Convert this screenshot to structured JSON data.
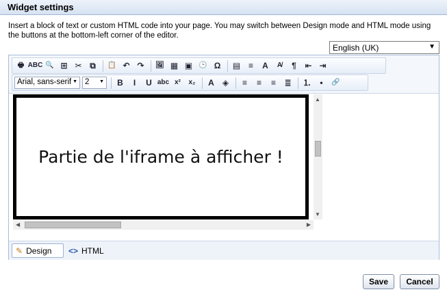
{
  "dialog": {
    "title": "Widget settings",
    "description": "Insert a block of text or custom HTML code into your page. You may switch between Design mode and HTML mode using the buttons at the bottom-left corner of the editor."
  },
  "language": {
    "selected": "English (UK)"
  },
  "toolbar": {
    "row1": [
      {
        "name": "print-icon",
        "glyph": "🖶"
      },
      {
        "name": "spellcheck-icon",
        "glyph": "ABC"
      },
      {
        "name": "find-icon",
        "glyph": "🔍"
      },
      {
        "name": "select-all-icon",
        "glyph": "⊞"
      },
      {
        "name": "cut-icon",
        "glyph": "✂"
      },
      {
        "name": "copy-icon",
        "glyph": "⧉"
      },
      {
        "name": "paste-icon",
        "glyph": "📋"
      },
      {
        "name": "undo-icon",
        "glyph": "↶"
      },
      {
        "name": "redo-icon",
        "glyph": "↷"
      },
      {
        "name": "insert-image-icon",
        "glyph": "🖼"
      },
      {
        "name": "image-gallery-icon",
        "glyph": "▦"
      },
      {
        "name": "insert-media-icon",
        "glyph": "▣"
      },
      {
        "name": "insert-date-icon",
        "glyph": "🕒"
      },
      {
        "name": "special-char-icon",
        "glyph": "Ω"
      },
      {
        "name": "table-icon",
        "glyph": "▤"
      },
      {
        "name": "paragraph-icon",
        "glyph": "≡"
      },
      {
        "name": "text-color-icon",
        "glyph": "A"
      },
      {
        "name": "clear-format-icon",
        "glyph": "A̸"
      },
      {
        "name": "show-marks-icon",
        "glyph": "¶"
      },
      {
        "name": "outdent-icon",
        "glyph": "⇤"
      },
      {
        "name": "indent-icon",
        "glyph": "⇥"
      }
    ],
    "font_family": "Arial, sans-serif",
    "font_size": "2",
    "row2": [
      {
        "name": "bold-icon",
        "glyph": "B"
      },
      {
        "name": "italic-icon",
        "glyph": "I"
      },
      {
        "name": "underline-icon",
        "glyph": "U"
      },
      {
        "name": "strikethrough-icon",
        "glyph": "abc"
      },
      {
        "name": "superscript-icon",
        "glyph": "x²"
      },
      {
        "name": "subscript-icon",
        "glyph": "x₂"
      },
      {
        "name": "font-color-icon",
        "glyph": "A"
      },
      {
        "name": "highlight-icon",
        "glyph": "◈"
      },
      {
        "name": "align-left-icon",
        "glyph": "≡"
      },
      {
        "name": "align-center-icon",
        "glyph": "≡"
      },
      {
        "name": "align-right-icon",
        "glyph": "≡"
      },
      {
        "name": "justify-icon",
        "glyph": "≣"
      },
      {
        "name": "ordered-list-icon",
        "glyph": "⒈"
      },
      {
        "name": "bullet-list-icon",
        "glyph": "•"
      },
      {
        "name": "link-icon",
        "glyph": "🔗"
      }
    ]
  },
  "content": {
    "frame_text": "Partie de l'iframe à afficher !"
  },
  "modes": {
    "design": "Design",
    "html": "HTML"
  },
  "buttons": {
    "save": "Save",
    "cancel": "Cancel"
  }
}
